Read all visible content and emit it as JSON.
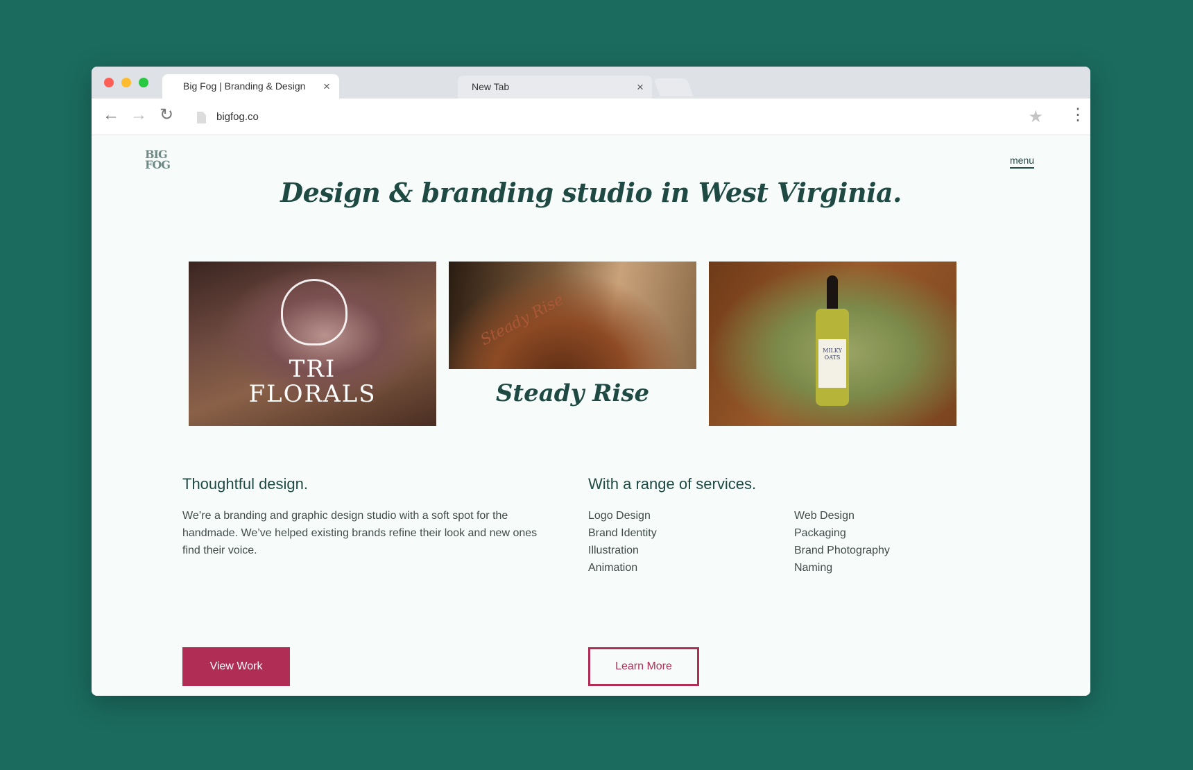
{
  "browser": {
    "tabs": [
      {
        "title": "Big Fog | Branding & Design Agency",
        "close": "×"
      },
      {
        "title": "New Tab",
        "close": "×"
      }
    ],
    "url": "bigfog.co",
    "icons": {
      "back": "back-arrow-icon",
      "forward": "forward-arrow-icon",
      "reload": "reload-icon",
      "star": "bookmark-star-icon",
      "menu": "kebab-menu-icon"
    }
  },
  "site": {
    "logo": "BIG FOG",
    "menu_label": "menu",
    "headline": "Design & branding studio in West Virginia.",
    "gallery": {
      "card1_text": "TRI FLORALS",
      "card2_caption": "Steady Rise",
      "card2_overlay": "Steady Rise",
      "card3_label": "MILKY OATS"
    },
    "about": {
      "heading": "Thoughtful design.",
      "body": "We’re a branding and graphic design studio with a soft spot for the handmade. We’ve helped existing brands refine their look and new ones find their voice.",
      "button": "View Work"
    },
    "services": {
      "heading": "With a range of services.",
      "left": [
        "Logo Design",
        "Brand Identity",
        "Illustration",
        "Animation"
      ],
      "right": [
        "Web Design",
        "Packaging",
        "Brand Photography",
        "Naming"
      ],
      "button": "Learn More"
    }
  },
  "colors": {
    "background": "#1b6b5f",
    "accent": "#b02d55",
    "heading": "#1f4a43"
  }
}
